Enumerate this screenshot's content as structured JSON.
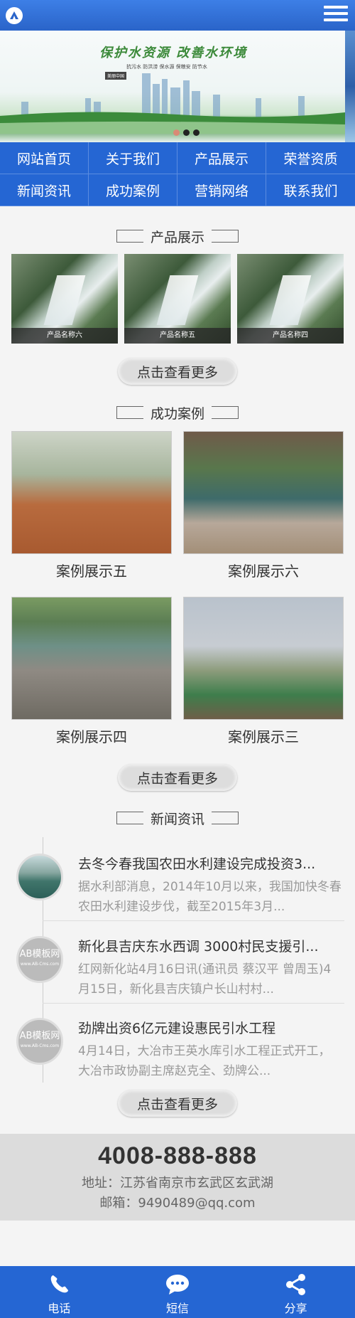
{
  "banner": {
    "slogan": "保护水资源 改善水环境",
    "subtitle": "抗污水 防洪涝 保水源 保粮安 防节水",
    "tag": "美丽中国"
  },
  "nav": [
    "网站首页",
    "关于我们",
    "产品展示",
    "荣誉资质",
    "新闻资讯",
    "成功案例",
    "营销网络",
    "联系我们"
  ],
  "products": {
    "title": "产品展示",
    "items": [
      "产品名称六",
      "产品名称五",
      "产品名称四"
    ],
    "more": "点击查看更多"
  },
  "cases": {
    "title": "成功案例",
    "items": [
      "案例展示五",
      "案例展示六",
      "案例展示四",
      "案例展示三"
    ],
    "more": "点击查看更多"
  },
  "news": {
    "title": "新闻资讯",
    "items": [
      {
        "title": "去冬今春我国农田水利建设完成投资3...",
        "desc": "据水利部消息，2014年10月以来，我国加快冬春农田水利建设步伐，截至2015年3月..."
      },
      {
        "title": "新化县吉庆东水西调 3000村民支援引...",
        "desc": "红网新化站4月16日讯(通讯员 蔡汉平 曾周玉)4月15日，新化县吉庆镇户长山村村..."
      },
      {
        "title": "劲牌出资6亿元建设惠民引水工程",
        "desc": "4月14日，大冶市王英水库引水工程正式开工，大冶市政协副主席赵克全、劲牌公..."
      }
    ],
    "thumb_text": "AB模板网",
    "thumb_sub": "www.AB-Cms.com",
    "more": "点击查看更多"
  },
  "contact": {
    "phone": "4008-888-888",
    "address": "地址：江苏省南京市玄武区玄武湖",
    "email": "邮箱：9490489@qq.com"
  },
  "bottom_bar": {
    "phone": "电话",
    "message": "短信",
    "share": "分享"
  },
  "colors": {
    "primary": "#2566d3",
    "header": "#3d7fe6"
  }
}
